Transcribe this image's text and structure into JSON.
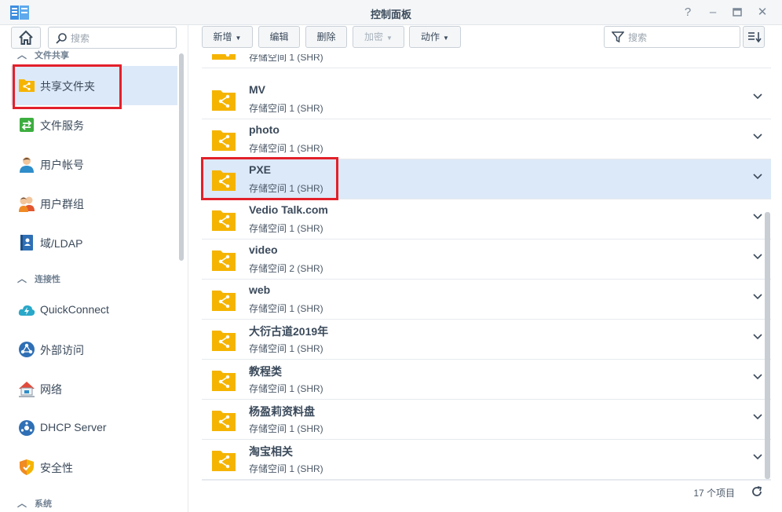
{
  "window": {
    "title": "控制面板"
  },
  "sidebar": {
    "search_placeholder": "搜索",
    "sections": [
      {
        "label": "文件共享"
      },
      {
        "label": "连接性"
      },
      {
        "label": "系统"
      }
    ],
    "items": [
      {
        "label": "共享文件夹",
        "icon": "shared-folder-icon"
      },
      {
        "label": "文件服务",
        "icon": "file-services-icon"
      },
      {
        "label": "用户帐号",
        "icon": "user-icon"
      },
      {
        "label": "用户群组",
        "icon": "group-icon"
      },
      {
        "label": "域/LDAP",
        "icon": "domain-ldap-icon"
      },
      {
        "label": "QuickConnect",
        "icon": "quickconnect-icon"
      },
      {
        "label": "外部访问",
        "icon": "external-access-icon"
      },
      {
        "label": "网络",
        "icon": "network-icon"
      },
      {
        "label": "DHCP Server",
        "icon": "dhcp-server-icon"
      },
      {
        "label": "安全性",
        "icon": "security-icon"
      }
    ]
  },
  "toolbar": {
    "create": "新增",
    "edit": "编辑",
    "delete": "删除",
    "encrypt": "加密",
    "action": "动作",
    "search_placeholder": "搜索"
  },
  "folders": [
    {
      "name": "",
      "volume": "存储空间 1 (SHR)"
    },
    {
      "name": "MV",
      "volume": "存储空间 1 (SHR)"
    },
    {
      "name": "photo",
      "volume": "存储空间 1 (SHR)"
    },
    {
      "name": "PXE",
      "volume": "存储空间 1 (SHR)"
    },
    {
      "name": "Vedio Talk.com",
      "volume": "存储空间 1 (SHR)"
    },
    {
      "name": "video",
      "volume": "存储空间 2 (SHR)"
    },
    {
      "name": "web",
      "volume": "存储空间 1 (SHR)"
    },
    {
      "name": "大衍古道2019年",
      "volume": "存储空间 1 (SHR)"
    },
    {
      "name": "教程类",
      "volume": "存储空间 1 (SHR)"
    },
    {
      "name": "杨盈莉资料盘",
      "volume": "存储空间 1 (SHR)"
    },
    {
      "name": "淘宝相关",
      "volume": "存储空间 1 (SHR)"
    }
  ],
  "footer": {
    "item_count": "17 个项目"
  },
  "colors": {
    "folder": "#f5b400",
    "selection": "#dce9f8",
    "highlight_box": "#e3202a",
    "accent": "#2f7dd1"
  }
}
